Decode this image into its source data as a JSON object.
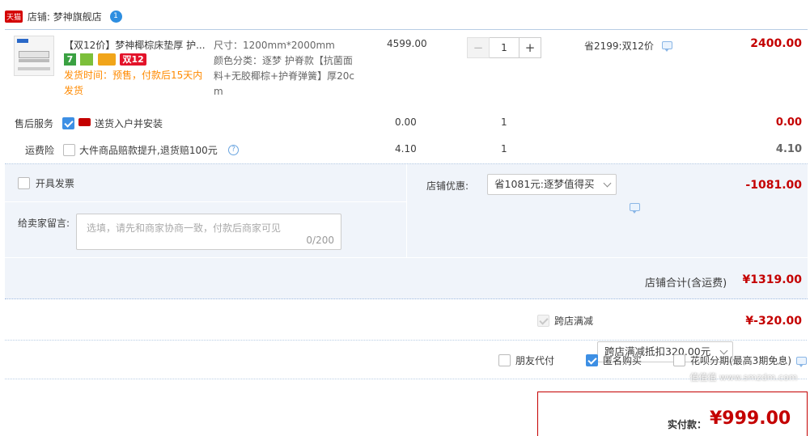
{
  "shop": {
    "badge": "天猫",
    "label": "店铺: 梦神旗舰店",
    "wangwang": "1"
  },
  "product": {
    "title": "【双12价】梦神椰棕床垫厚 护...",
    "badges": [
      "7",
      "",
      "",
      "双12"
    ],
    "ship_note": "发货时间：预售，付款后15天内发货",
    "spec_size": "尺寸：1200mm*2000mm",
    "spec_color": "颜色分类：逐梦 护脊款【抗菌面料+无胶椰棕+护脊弹簧】厚20cm",
    "unit_price": "4599.00",
    "quantity": "1",
    "minus": "−",
    "plus": "+",
    "discount_note": "省2199:双12价",
    "subtotal": "2400.00"
  },
  "services": [
    {
      "label": "售后服务",
      "name": "送货入户并安装",
      "price": "0.00",
      "qty": "1",
      "total": "0.00"
    },
    {
      "label": "运费险",
      "name": "大件商品赔款提升,退货赔100元",
      "help": "?",
      "price": "4.10",
      "qty": "1",
      "total": "4.10"
    }
  ],
  "invoice": {
    "label": "开具发票"
  },
  "shop_discount": {
    "label": "店铺优惠:",
    "selected": "省1081元:逐梦值得买",
    "amount": "-1081.00"
  },
  "message": {
    "label": "给卖家留言:",
    "placeholder": "选填，请先和商家协商一致，付款后商家可见",
    "counter": "0/200"
  },
  "shop_total": {
    "label": "店铺合计(含运费)",
    "amount": "¥1319.00"
  },
  "cross_shop": {
    "label": "跨店满减",
    "selected": "跨店满减抵扣320.00元",
    "amount": "¥-320.00"
  },
  "options": {
    "friend_pay": "朋友代付",
    "anonymous": "匿名购买",
    "huabei": "花呗分期(最高3期免息)"
  },
  "pay": {
    "label": "实付款：",
    "amount": "¥999.00"
  },
  "watermark": "值值值 www.smzdm.com",
  "colors": {
    "accent_red": "#c40000",
    "blue_bg": "#f0f4fa",
    "check_blue": "#3d8fe4"
  }
}
